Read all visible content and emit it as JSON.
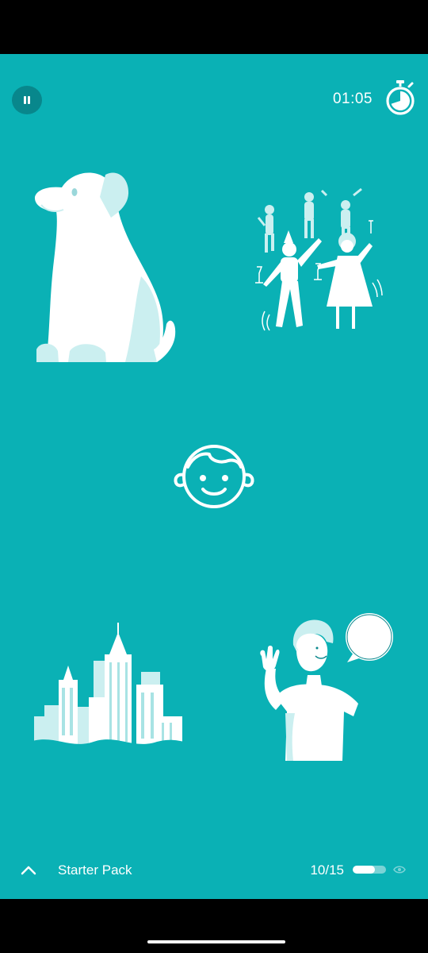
{
  "timer": {
    "value": "01:05"
  },
  "pack": {
    "name": "Starter Pack"
  },
  "progress": {
    "count": "10/15",
    "fraction": 0.6667
  },
  "colors": {
    "background": "#0ab1b5",
    "pause_bg": "#08878c",
    "art_white": "#ffffff",
    "art_shade": "#cbeff0"
  },
  "icons": {
    "pause": "pause-icon",
    "stopwatch": "stopwatch-icon",
    "face": "face-icon",
    "chevron": "chevron-up-icon",
    "eye": "eye-icon"
  },
  "pictures": [
    "dog",
    "party",
    "city",
    "waving-man"
  ]
}
